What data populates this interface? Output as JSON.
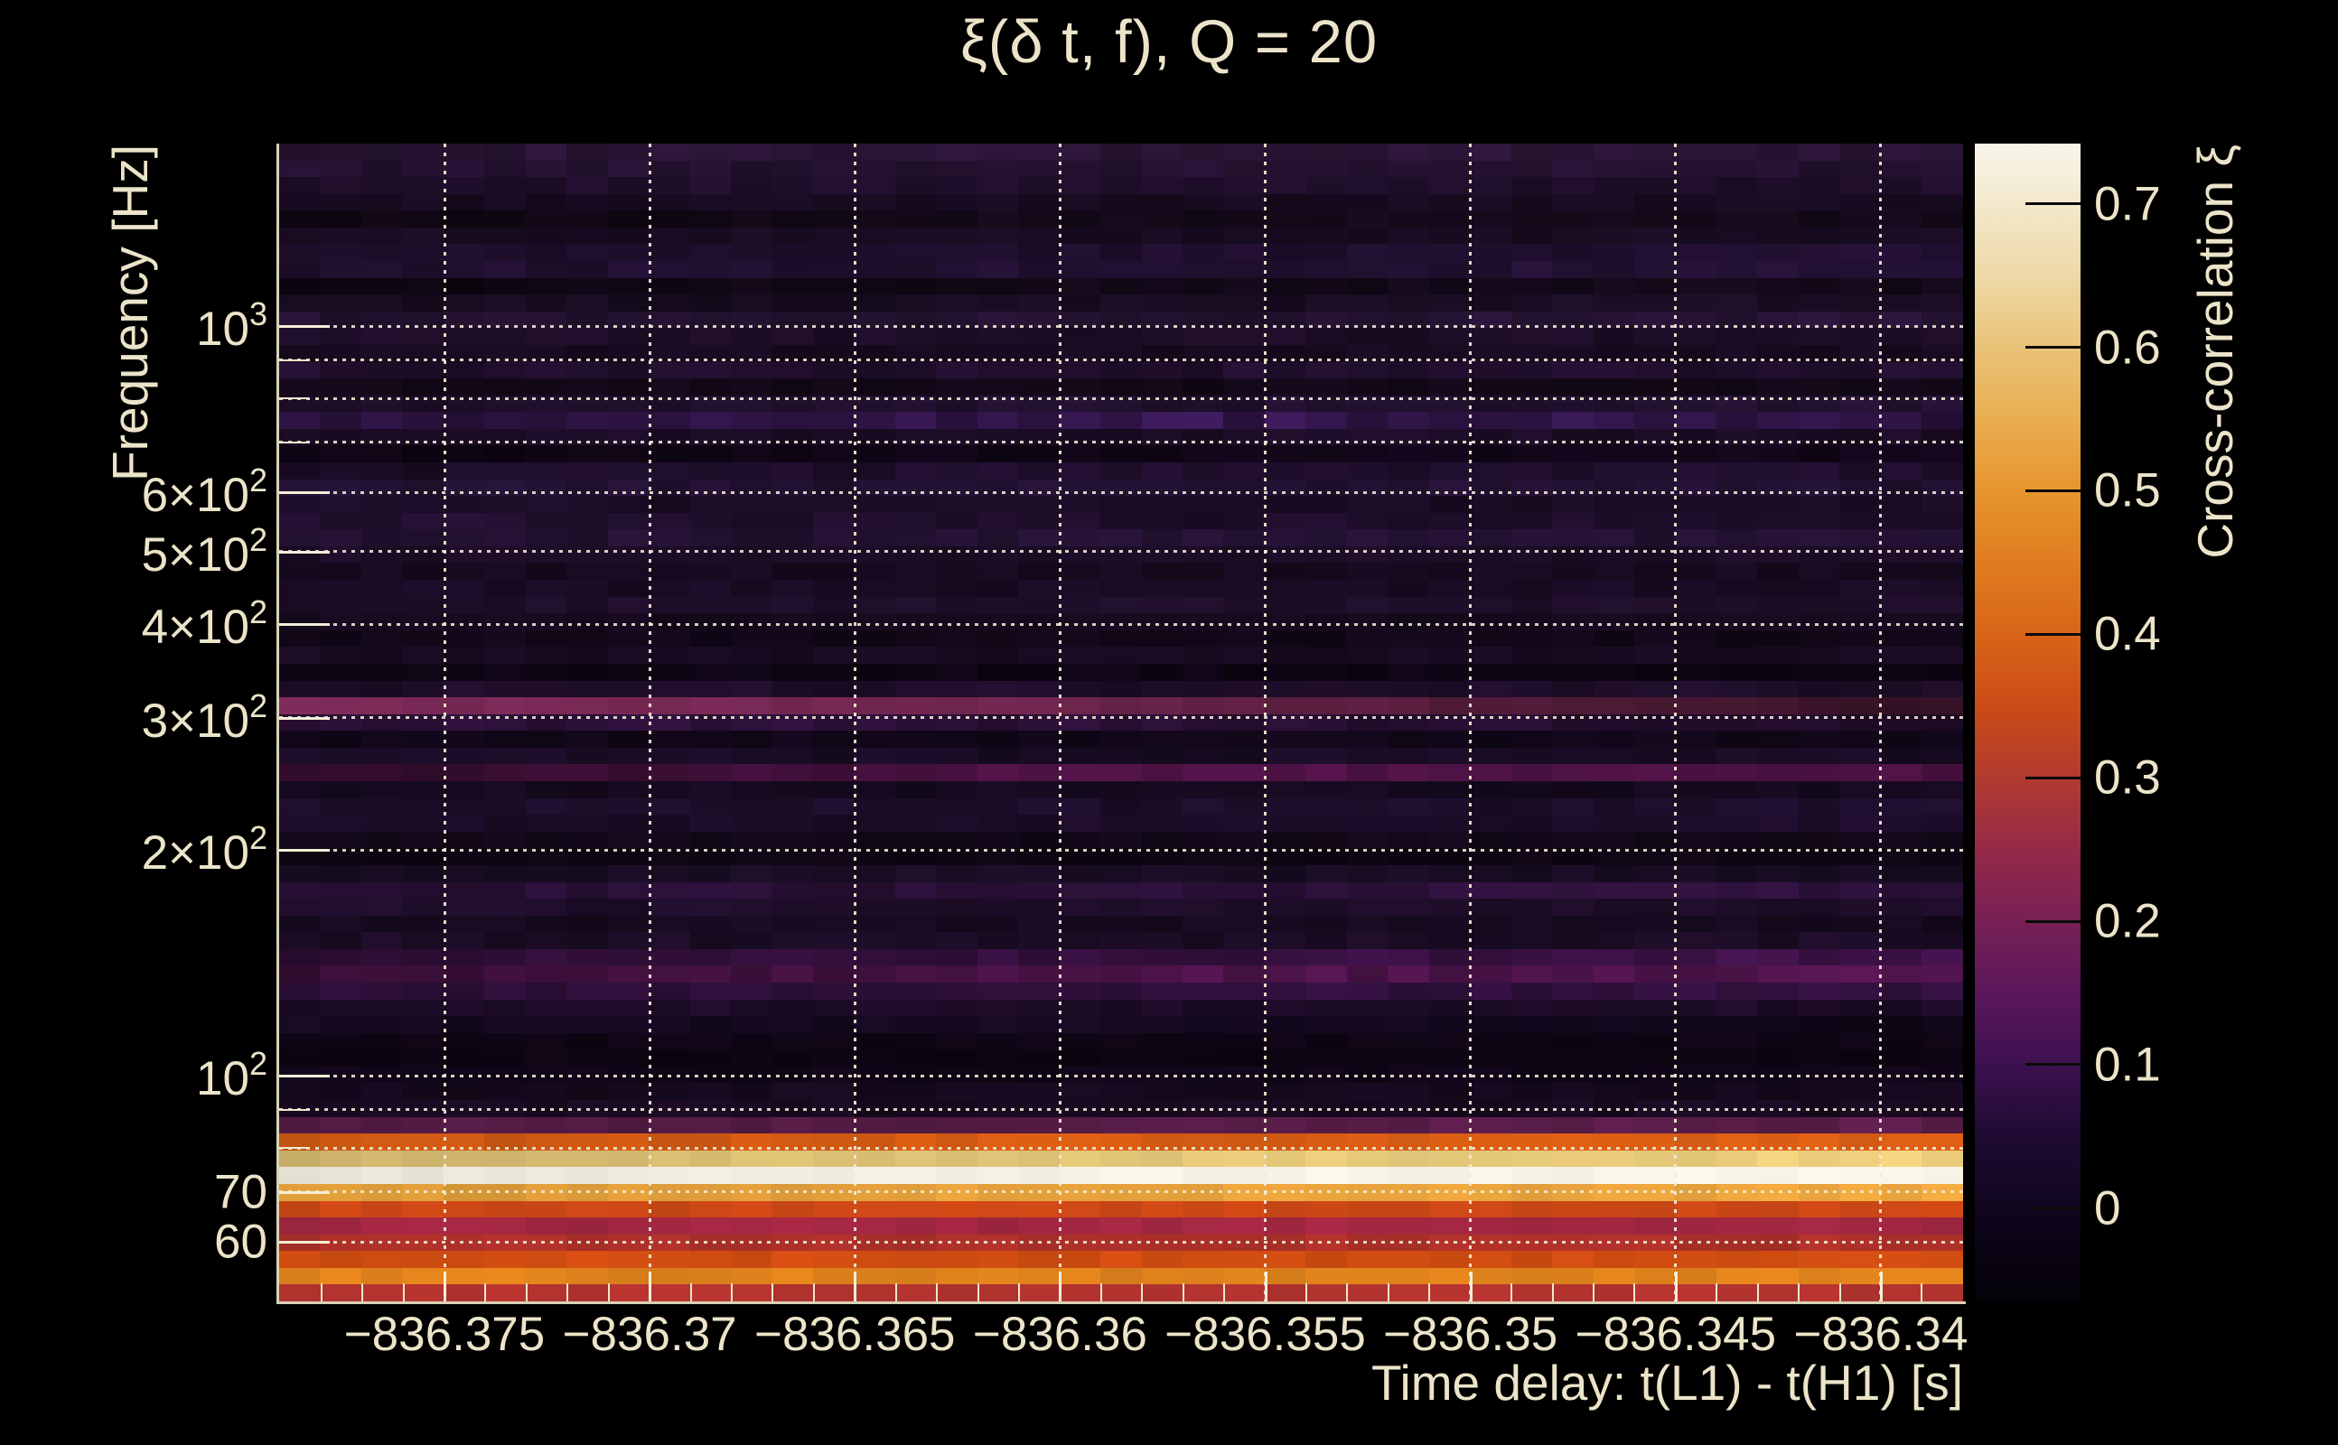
{
  "title": "ξ(δ t, f), Q = 20",
  "axes": {
    "x": {
      "title": "Time delay: t(L1) - t(H1) [s]",
      "ticks": [
        {
          "t": -836.375,
          "label": "−836.375"
        },
        {
          "t": -836.37,
          "label": "−836.37"
        },
        {
          "t": -836.365,
          "label": "−836.365"
        },
        {
          "t": -836.36,
          "label": "−836.36"
        },
        {
          "t": -836.355,
          "label": "−836.355"
        },
        {
          "t": -836.35,
          "label": "−836.35"
        },
        {
          "t": -836.345,
          "label": "−836.345"
        },
        {
          "t": -836.34,
          "label": "−836.34"
        }
      ],
      "minor_tick_step_s": 0.001,
      "range_s": [
        -836.379,
        -836.338
      ]
    },
    "y": {
      "title": "Frequency [Hz]",
      "scale": "log",
      "range_hz": [
        50,
        1751
      ],
      "labeled_ticks": [
        {
          "f": 1000,
          "base": "10",
          "sup": "3"
        },
        {
          "f": 600,
          "base": "6×10",
          "sup": "2"
        },
        {
          "f": 500,
          "base": "5×10",
          "sup": "2"
        },
        {
          "f": 400,
          "base": "4×10",
          "sup": "2"
        },
        {
          "f": 300,
          "base": "3×10",
          "sup": "2"
        },
        {
          "f": 200,
          "base": "2×10",
          "sup": "2"
        },
        {
          "f": 100,
          "base": "10",
          "sup": "2"
        },
        {
          "f": 70,
          "base": "70",
          "sup": ""
        },
        {
          "f": 60,
          "base": "60",
          "sup": ""
        }
      ],
      "gridline_freqs_hz": [
        1000,
        900,
        800,
        700,
        600,
        500,
        400,
        300,
        200,
        100,
        90,
        80,
        70,
        60
      ],
      "minor_only_freqs_hz": [
        900,
        800,
        700,
        90,
        80
      ]
    }
  },
  "colorbar": {
    "title": "Cross-correlation ξ",
    "tick_labels": [
      "0.7",
      "0.6",
      "0.5",
      "0.4",
      "0.3",
      "0.2",
      "0.1",
      "0"
    ],
    "tick_values": [
      0.7,
      0.6,
      0.5,
      0.4,
      0.3,
      0.2,
      0.1,
      0
    ],
    "value_range": [
      -0.065,
      0.742
    ],
    "gradient_stops_bottom_to_top": [
      [
        0,
        "#040107"
      ],
      [
        0.08,
        "#10061f"
      ],
      [
        0.145,
        "#1f0b33"
      ],
      [
        0.205,
        "#3d1150"
      ],
      [
        0.265,
        "#5a175b"
      ],
      [
        0.33,
        "#782055"
      ],
      [
        0.39,
        "#952a48"
      ],
      [
        0.45,
        "#b13a30"
      ],
      [
        0.515,
        "#cb4c17"
      ],
      [
        0.575,
        "#d86418"
      ],
      [
        0.64,
        "#e07d20"
      ],
      [
        0.7,
        "#e6952f"
      ],
      [
        0.76,
        "#e9ad4f"
      ],
      [
        0.825,
        "#e9c379"
      ],
      [
        0.885,
        "#eed8a6"
      ],
      [
        0.95,
        "#f3e9cd"
      ],
      [
        1,
        "#f8f5ea"
      ]
    ]
  },
  "colors": {
    "background": "#000000",
    "text": "#ece4c9",
    "grid_dots": "#f2ecd6",
    "axis_line": "#d9d1b6"
  },
  "chart_data": {
    "type": "heatmap",
    "title": "ξ(δ t, f), Q = 20",
    "xlabel": "Time delay: t(L1) - t(H1) [s]",
    "ylabel": "Frequency [Hz]",
    "zlabel": "Cross-correlation ξ",
    "x_range_s": [
      -836.379,
      -836.338
    ],
    "y_range_hz": [
      50,
      1751
    ],
    "y_scale": "log",
    "z_range": [
      -0.06,
      0.74
    ],
    "colormap": "magma-like (black-purple-magenta-orange-cream)",
    "n_time_columns": 41,
    "notable_features": [
      "Very bright cream band (ξ ≈ 0.73) at ~72–82 Hz spanning all time delays",
      "Khaki/goldenrod/orange bands (ξ ≈ 0.4–0.6) surrounding the bright band, 55–90 Hz",
      "Red/orange rows (ξ ≈ 0.25–0.46) from 50–65 Hz at plot bottom",
      "Magenta row (ξ ≈ 0.17) just above 300 Hz, fading toward later time delays",
      "Magenta-plum row (ξ ≈ 0.11) near 250 Hz, brighter at later time delays",
      "Purple band (ξ ≈ 0.10) near 140–150 Hz",
      "Background mostly dark purple/near-black, ξ ≈ 0 – 0.07"
    ],
    "rows": [
      {
        "f_top_hz": 1751,
        "xi": 0.055,
        "c": "#291434",
        "v": 0.18,
        "p": [
          1,
          1,
          1
        ]
      },
      {
        "f_top_hz": 1663,
        "xi": 0.05,
        "c": "#241130",
        "v": 0.18,
        "p": [
          1,
          1,
          1
        ]
      },
      {
        "f_top_hz": 1580,
        "xi": 0.045,
        "c": "#1f0e2a",
        "v": 0.18,
        "p": [
          1,
          1,
          1
        ]
      },
      {
        "f_top_hz": 1500,
        "xi": 0.035,
        "c": "#170b20",
        "v": 0.2,
        "p": [
          1,
          1,
          1
        ]
      },
      {
        "f_top_hz": 1425,
        "xi": 0.03,
        "c": "#140919",
        "v": 0.22,
        "p": [
          0.72,
          1,
          1.05
        ]
      },
      {
        "f_top_hz": 1353,
        "xi": 0.04,
        "c": "#190c22",
        "v": 0.18,
        "p": [
          1,
          1,
          1
        ]
      },
      {
        "f_top_hz": 1285,
        "xi": 0.05,
        "c": "#1e0e2c",
        "v": 0.18,
        "p": [
          0.9,
          1,
          1.1
        ]
      },
      {
        "f_top_hz": 1221,
        "xi": 0.055,
        "c": "#211031",
        "v": 0.2,
        "p": [
          0.95,
          1.05,
          1
        ]
      },
      {
        "f_top_hz": 1160,
        "xi": 0.03,
        "c": "#130919",
        "v": 0.25,
        "p": [
          0.6,
          1,
          1.05
        ]
      },
      {
        "f_top_hz": 1101,
        "xi": 0.04,
        "c": "#180c21",
        "v": 0.2,
        "p": [
          0.95,
          1,
          1.15
        ]
      },
      {
        "f_top_hz": 1046,
        "xi": 0.055,
        "c": "#241231",
        "v": 0.18,
        "p": [
          0.95,
          1,
          1.1
        ]
      },
      {
        "f_top_hz": 993,
        "xi": 0.045,
        "c": "#1d0d27",
        "v": 0.18,
        "p": [
          1,
          1,
          1
        ]
      },
      {
        "f_top_hz": 943,
        "xi": 0.04,
        "c": "#180a20",
        "v": 0.2,
        "p": [
          1,
          1,
          1
        ]
      },
      {
        "f_top_hz": 896,
        "xi": 0.045,
        "c": "#200e2c",
        "v": 0.22,
        "p": [
          1,
          1,
          1
        ]
      },
      {
        "f_top_hz": 851,
        "xi": 0.03,
        "c": "#130818",
        "v": 0.2,
        "p": [
          1,
          1,
          1
        ]
      },
      {
        "f_top_hz": 808,
        "xi": 0.05,
        "c": "#1f0f2b",
        "v": 0.2,
        "p": [
          0.9,
          1,
          1.15
        ]
      },
      {
        "f_top_hz": 767,
        "xi": 0.07,
        "c": "#2c1342",
        "v": 0.25,
        "p": [
          0.85,
          1.2,
          0.95
        ]
      },
      {
        "f_top_hz": 728,
        "xi": 0.04,
        "c": "#1b0c25",
        "v": 0.2,
        "p": [
          1,
          1,
          1
        ]
      },
      {
        "f_top_hz": 692,
        "xi": 0.025,
        "c": "#100617",
        "v": 0.22,
        "p": [
          0.8,
          1,
          1.1
        ]
      },
      {
        "f_top_hz": 657,
        "xi": 0.045,
        "c": "#1d0d29",
        "v": 0.22,
        "p": [
          0.85,
          1.15,
          1
        ]
      },
      {
        "f_top_hz": 624,
        "xi": 0.055,
        "c": "#221132",
        "v": 0.18,
        "p": [
          1,
          1,
          1
        ]
      },
      {
        "f_top_hz": 592,
        "xi": 0.04,
        "c": "#1b0c25",
        "v": 0.18,
        "p": [
          1.1,
          0.95,
          1
        ]
      },
      {
        "f_top_hz": 562,
        "xi": 0.05,
        "c": "#1f0e2b",
        "v": 0.2,
        "p": [
          1.15,
          0.95,
          1
        ]
      },
      {
        "f_top_hz": 534,
        "xi": 0.055,
        "c": "#231132",
        "v": 0.18,
        "p": [
          1,
          1,
          1
        ]
      },
      {
        "f_top_hz": 507,
        "xi": 0.045,
        "c": "#1c0c26",
        "v": 0.18,
        "p": [
          1,
          1,
          1
        ]
      },
      {
        "f_top_hz": 481,
        "xi": 0.035,
        "c": "#160a1f",
        "v": 0.2,
        "p": [
          1,
          1,
          1
        ]
      },
      {
        "f_top_hz": 457,
        "xi": 0.04,
        "c": "#190b23",
        "v": 0.2,
        "p": [
          1,
          1,
          1
        ]
      },
      {
        "f_top_hz": 434,
        "xi": 0.045,
        "c": "#1e0e29",
        "v": 0.18,
        "p": [
          1,
          1,
          1
        ]
      },
      {
        "f_top_hz": 412,
        "xi": 0.03,
        "c": "#150a1d",
        "v": 0.2,
        "p": [
          1,
          1,
          1
        ]
      },
      {
        "f_top_hz": 391,
        "xi": 0.025,
        "c": "#120718",
        "v": 0.22,
        "p": [
          1,
          1,
          1
        ]
      },
      {
        "f_top_hz": 371,
        "xi": 0.04,
        "c": "#180b21",
        "v": 0.2,
        "p": [
          1,
          1,
          1
        ]
      },
      {
        "f_top_hz": 353,
        "xi": 0.02,
        "c": "#0d0513",
        "v": 0.25,
        "p": [
          1,
          1,
          1
        ]
      },
      {
        "f_top_hz": 335,
        "xi": 0.045,
        "c": "#1e0d29",
        "v": 0.2,
        "p": [
          1,
          1,
          1
        ]
      },
      {
        "f_top_hz": 318,
        "xi": 0.17,
        "c": "#7c2a57",
        "v": 0.08,
        "p": [
          1.05,
          0.85,
          0.42
        ]
      },
      {
        "f_top_hz": 302,
        "xi": 0.06,
        "c": "#2c1038",
        "v": 0.2,
        "p": [
          1,
          0.95,
          0.8
        ]
      },
      {
        "f_top_hz": 287,
        "xi": 0.025,
        "c": "#110719",
        "v": 0.22,
        "p": [
          1,
          1,
          1
        ]
      },
      {
        "f_top_hz": 273,
        "xi": 0.04,
        "c": "#190c25",
        "v": 0.2,
        "p": [
          1,
          1,
          1
        ]
      },
      {
        "f_top_hz": 259,
        "xi": 0.11,
        "c": "#4c1243",
        "v": 0.12,
        "p": [
          0.6,
          1.05,
          1
        ]
      },
      {
        "f_top_hz": 246,
        "xi": 0.03,
        "c": "#150a1f",
        "v": 0.2,
        "p": [
          1,
          1,
          1
        ]
      },
      {
        "f_top_hz": 234,
        "xi": 0.045,
        "c": "#1c0d29",
        "v": 0.2,
        "p": [
          1,
          1,
          1
        ]
      },
      {
        "f_top_hz": 222,
        "xi": 0.05,
        "c": "#1c0c28",
        "v": 0.2,
        "p": [
          1,
          1,
          1
        ]
      },
      {
        "f_top_hz": 211,
        "xi": 0.025,
        "c": "#120819",
        "v": 0.2,
        "p": [
          1,
          1,
          1
        ]
      },
      {
        "f_top_hz": 200,
        "xi": 0.02,
        "c": "#0e0613",
        "v": 0.22,
        "p": [
          1,
          1,
          1
        ]
      },
      {
        "f_top_hz": 190,
        "xi": 0.04,
        "c": "#190d24",
        "v": 0.2,
        "p": [
          1,
          1,
          1
        ]
      },
      {
        "f_top_hz": 181,
        "xi": 0.06,
        "c": "#2a1037",
        "v": 0.18,
        "p": [
          0.9,
          1,
          1.1
        ]
      },
      {
        "f_top_hz": 172,
        "xi": 0.045,
        "c": "#1e0d29",
        "v": 0.18,
        "p": [
          1,
          1,
          1
        ]
      },
      {
        "f_top_hz": 163,
        "xi": 0.035,
        "c": "#170a20",
        "v": 0.2,
        "p": [
          1,
          1,
          1
        ]
      },
      {
        "f_top_hz": 155,
        "xi": 0.04,
        "c": "#1b0c25",
        "v": 0.2,
        "p": [
          1,
          1,
          1
        ]
      },
      {
        "f_top_hz": 147,
        "xi": 0.08,
        "c": "#36103f",
        "v": 0.18,
        "p": [
          0.8,
          1,
          1.15
        ]
      },
      {
        "f_top_hz": 140,
        "xi": 0.1,
        "c": "#471244",
        "v": 0.15,
        "p": [
          0.75,
          1.05,
          1.2
        ]
      },
      {
        "f_top_hz": 133,
        "xi": 0.065,
        "c": "#30103c",
        "v": 0.15,
        "p": [
          0.9,
          1,
          1.05
        ]
      },
      {
        "f_top_hz": 126,
        "xi": 0.04,
        "c": "#1c0b26",
        "v": 0.2,
        "p": [
          1,
          1,
          1
        ]
      },
      {
        "f_top_hz": 120,
        "xi": 0.03,
        "c": "#140920",
        "v": 0.2,
        "p": [
          1.05,
          1,
          0.75
        ]
      },
      {
        "f_top_hz": 114,
        "xi": 0.025,
        "c": "#0f0615",
        "v": 0.22,
        "p": [
          1,
          1,
          1
        ]
      },
      {
        "f_top_hz": 108,
        "xi": 0.02,
        "c": "#0d0512",
        "v": 0.22,
        "p": [
          1,
          1,
          1
        ]
      },
      {
        "f_top_hz": 103,
        "xi": 0.025,
        "c": "#100618",
        "v": 0.2,
        "p": [
          1,
          1,
          1
        ]
      },
      {
        "f_top_hz": 98,
        "xi": 0.03,
        "c": "#15091d",
        "v": 0.2,
        "p": [
          1,
          1,
          1
        ]
      },
      {
        "f_top_hz": 93,
        "xi": 0.035,
        "c": "#190a21",
        "v": 0.2,
        "p": [
          1,
          1,
          1
        ]
      },
      {
        "f_top_hz": 88,
        "xi": 0.145,
        "c": "#561c46",
        "v": 0.1,
        "p": [
          0.95,
          1,
          1.05
        ]
      },
      {
        "f_top_hz": 84,
        "xi": 0.43,
        "c": "#d75c13",
        "v": 0.05,
        "p": [
          0.93,
          1,
          1.03
        ]
      },
      {
        "f_top_hz": 80,
        "xi": 0.6,
        "c": "#e2c577",
        "v": 0.04,
        "p": [
          0.9,
          1.02,
          1.05
        ]
      },
      {
        "f_top_hz": 76,
        "xi": 0.73,
        "c": "#f4f1e3",
        "v": 0.02,
        "p": [
          0.95,
          1.01,
          1.02
        ]
      },
      {
        "f_top_hz": 72,
        "xi": 0.52,
        "c": "#e7a23c",
        "v": 0.04,
        "p": [
          0.95,
          1,
          1.02
        ]
      },
      {
        "f_top_hz": 69,
        "xi": 0.38,
        "c": "#cb4716",
        "v": 0.05,
        "p": [
          1,
          1,
          1
        ]
      },
      {
        "f_top_hz": 65,
        "xi": 0.26,
        "c": "#a22741",
        "v": 0.06,
        "p": [
          1,
          1,
          1
        ]
      },
      {
        "f_top_hz": 62,
        "xi": 0.3,
        "c": "#ac3029",
        "v": 0.06,
        "p": [
          1,
          1,
          1
        ]
      },
      {
        "f_top_hz": 59,
        "xi": 0.39,
        "c": "#cf4c11",
        "v": 0.05,
        "p": [
          1,
          1,
          1
        ]
      },
      {
        "f_top_hz": 56,
        "xi": 0.46,
        "c": "#df821c",
        "v": 0.05,
        "p": [
          1,
          1,
          1
        ]
      },
      {
        "f_top_hz": 53,
        "xi": 0.31,
        "c": "#b2332e",
        "v": 0.05,
        "p": [
          1,
          1,
          1
        ]
      }
    ]
  }
}
